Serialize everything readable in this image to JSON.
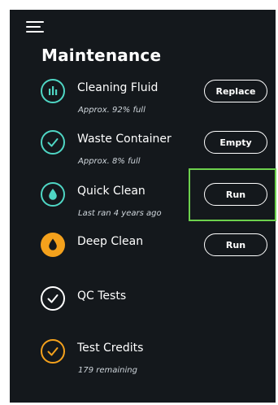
{
  "colors": {
    "panel_bg": "#14181c",
    "teal": "#4fd6c4",
    "orange": "#f4a11c",
    "white": "#ffffff",
    "highlight": "#6dd14d"
  },
  "header": {
    "menu_icon": "hamburger-menu-icon",
    "title": "Maintenance"
  },
  "items": [
    {
      "name": "Cleaning Fluid",
      "sub": "Approx. 92% full",
      "button": "Replace",
      "icon": "bar-chart-icon",
      "color": "teal"
    },
    {
      "name": "Waste Container",
      "sub": "Approx. 8% full",
      "button": "Empty",
      "icon": "check-circle-icon",
      "color": "teal"
    },
    {
      "name": "Quick Clean",
      "sub": "Last ran 4 years ago",
      "button": "Run",
      "icon": "droplet-icon",
      "color": "teal"
    },
    {
      "name": "Deep Clean",
      "sub": "",
      "button": "Run",
      "icon": "droplet-icon",
      "color": "orange"
    },
    {
      "name": "QC Tests",
      "sub": "",
      "button": "",
      "icon": "check-circle-icon",
      "color": "white"
    },
    {
      "name": "Test Credits",
      "sub": "179 remaining",
      "button": "",
      "icon": "check-circle-icon",
      "color": "orange"
    }
  ]
}
